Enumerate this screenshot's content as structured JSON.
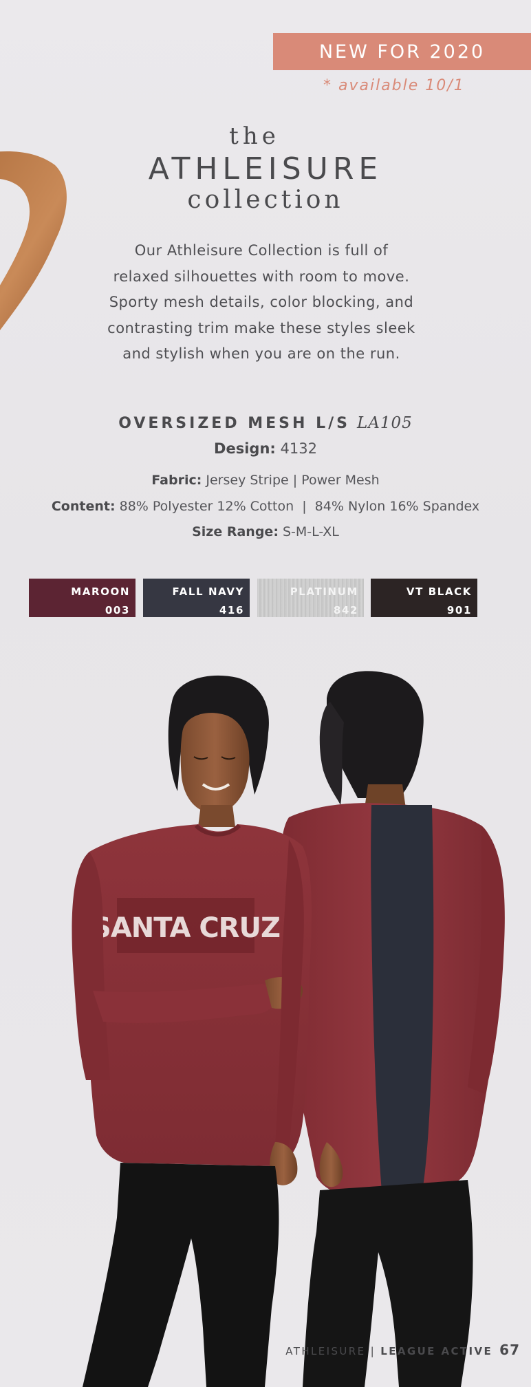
{
  "banner": {
    "new_label": "NEW FOR 2020",
    "availability": "* available 10/1",
    "accent_color": "#d98a78"
  },
  "title": {
    "the": "the",
    "main": "ATHLEISURE",
    "collection": "collection"
  },
  "intro": {
    "lines": [
      "Our Athleisure Collection is full of",
      "relaxed silhouettes with room to move.",
      "Sporty mesh details, color blocking, and",
      "contrasting trim make these styles sleek",
      "and stylish when you are on the run."
    ]
  },
  "product": {
    "name": "OVERSIZED MESH L/S",
    "sku": "LA105",
    "design_label": "Design:",
    "design_value": "4132",
    "fabric_label": "Fabric:",
    "fabric_value": "Jersey Stripe | Power Mesh",
    "content_label": "Content:",
    "content_value": "88% Polyester 12% Cotton  |  84% Nylon 16% Spandex",
    "size_label": "Size Range:",
    "size_value": "S-M-L-XL"
  },
  "swatches": [
    {
      "name": "MAROON",
      "code": "003",
      "color": "#5c2433"
    },
    {
      "name": "FALL NAVY",
      "code": "416",
      "color": "#363742"
    },
    {
      "name": "PLATINUM",
      "code": "842",
      "color": "#cacaca"
    },
    {
      "name": "VT BLACK",
      "code": "901",
      "color": "#2c2424"
    }
  ],
  "photo": {
    "shirt_print": "SANTA CRUZ",
    "shirt_color": "#8a3138",
    "panel_color": "#2b2f3a"
  },
  "footer": {
    "section": "ATHLEISURE",
    "separator": " | ",
    "brand": "LEAGUE ACTIVE",
    "page_number": "67"
  }
}
